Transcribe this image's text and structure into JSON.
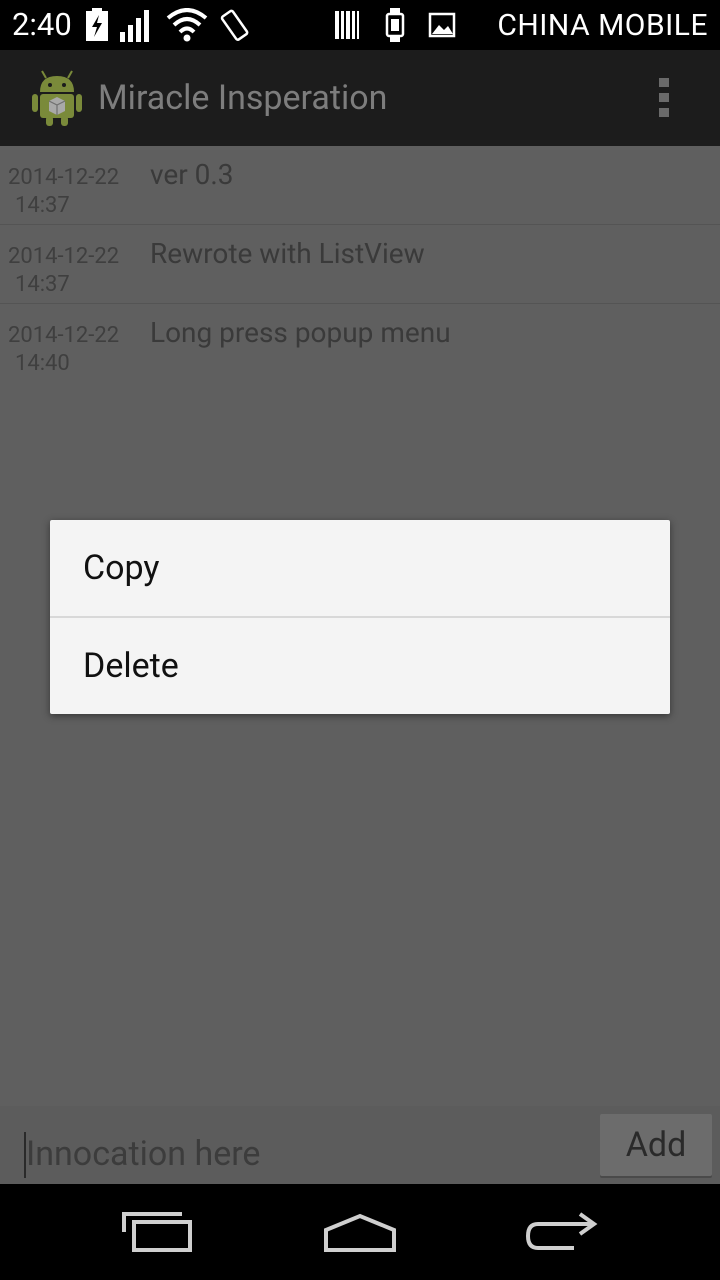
{
  "status_bar": {
    "time": "2:40",
    "carrier": "CHINA  MOBILE",
    "icons": [
      "battery-charging-icon",
      "signal-icon",
      "wifi-icon",
      "rotate-icon",
      "barcode-icon",
      "watch-icon",
      "image-icon"
    ]
  },
  "action_bar": {
    "title": "Miracle Insperation",
    "overflow_icon": "overflow-menu-icon"
  },
  "list": {
    "items": [
      {
        "date": "2014-12-22",
        "time": "14:37",
        "text": "ver 0.3"
      },
      {
        "date": "2014-12-22",
        "time": "14:37",
        "text": "Rewrote with ListView"
      },
      {
        "date": "2014-12-22",
        "time": "14:40",
        "text": "Long press popup menu"
      }
    ]
  },
  "popup_menu": {
    "items": [
      {
        "label": "Copy"
      },
      {
        "label": "Delete"
      }
    ]
  },
  "input_bar": {
    "placeholder": "Innocation here",
    "value": "",
    "add_label": "Add"
  },
  "nav_bar": {
    "buttons": [
      "recent-apps-icon",
      "home-icon",
      "back-icon"
    ]
  },
  "colors": {
    "dim_overlay_bg": "#5f5f5f",
    "popup_bg": "#f4f4f4",
    "action_bar_bg": "#1c1c1c"
  }
}
